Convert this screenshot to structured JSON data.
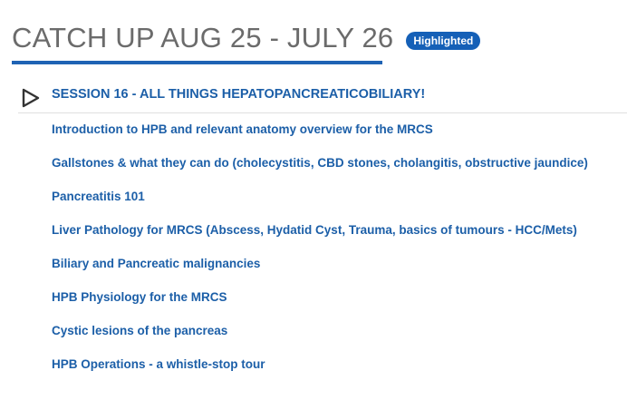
{
  "section": {
    "title": "CATCH UP AUG 25 - JULY 26",
    "badge": "Highlighted"
  },
  "session": {
    "icon": "play-icon",
    "title": "SESSION 16 - ALL THINGS HEPATOPANCREATICOBILIARY!"
  },
  "lessons": [
    "Introduction to HPB and relevant anatomy overview for the MRCS",
    "Gallstones & what they can do (cholecystitis, CBD stones, cholangitis, obstructive jaundice)",
    "Pancreatitis 101",
    "Liver Pathology for MRCS (Abscess, Hydatid Cyst, Trauma, basics of tumours - HCC/Mets)",
    "Biliary and Pancreatic malignancies",
    "HPB Physiology for the MRCS",
    "Cystic lesions of the pancreas",
    "HPB Operations - a whistle-stop tour"
  ],
  "colors": {
    "accent": "#1f63b4",
    "link": "#1c5fa8",
    "heading": "#6b6b6b"
  }
}
